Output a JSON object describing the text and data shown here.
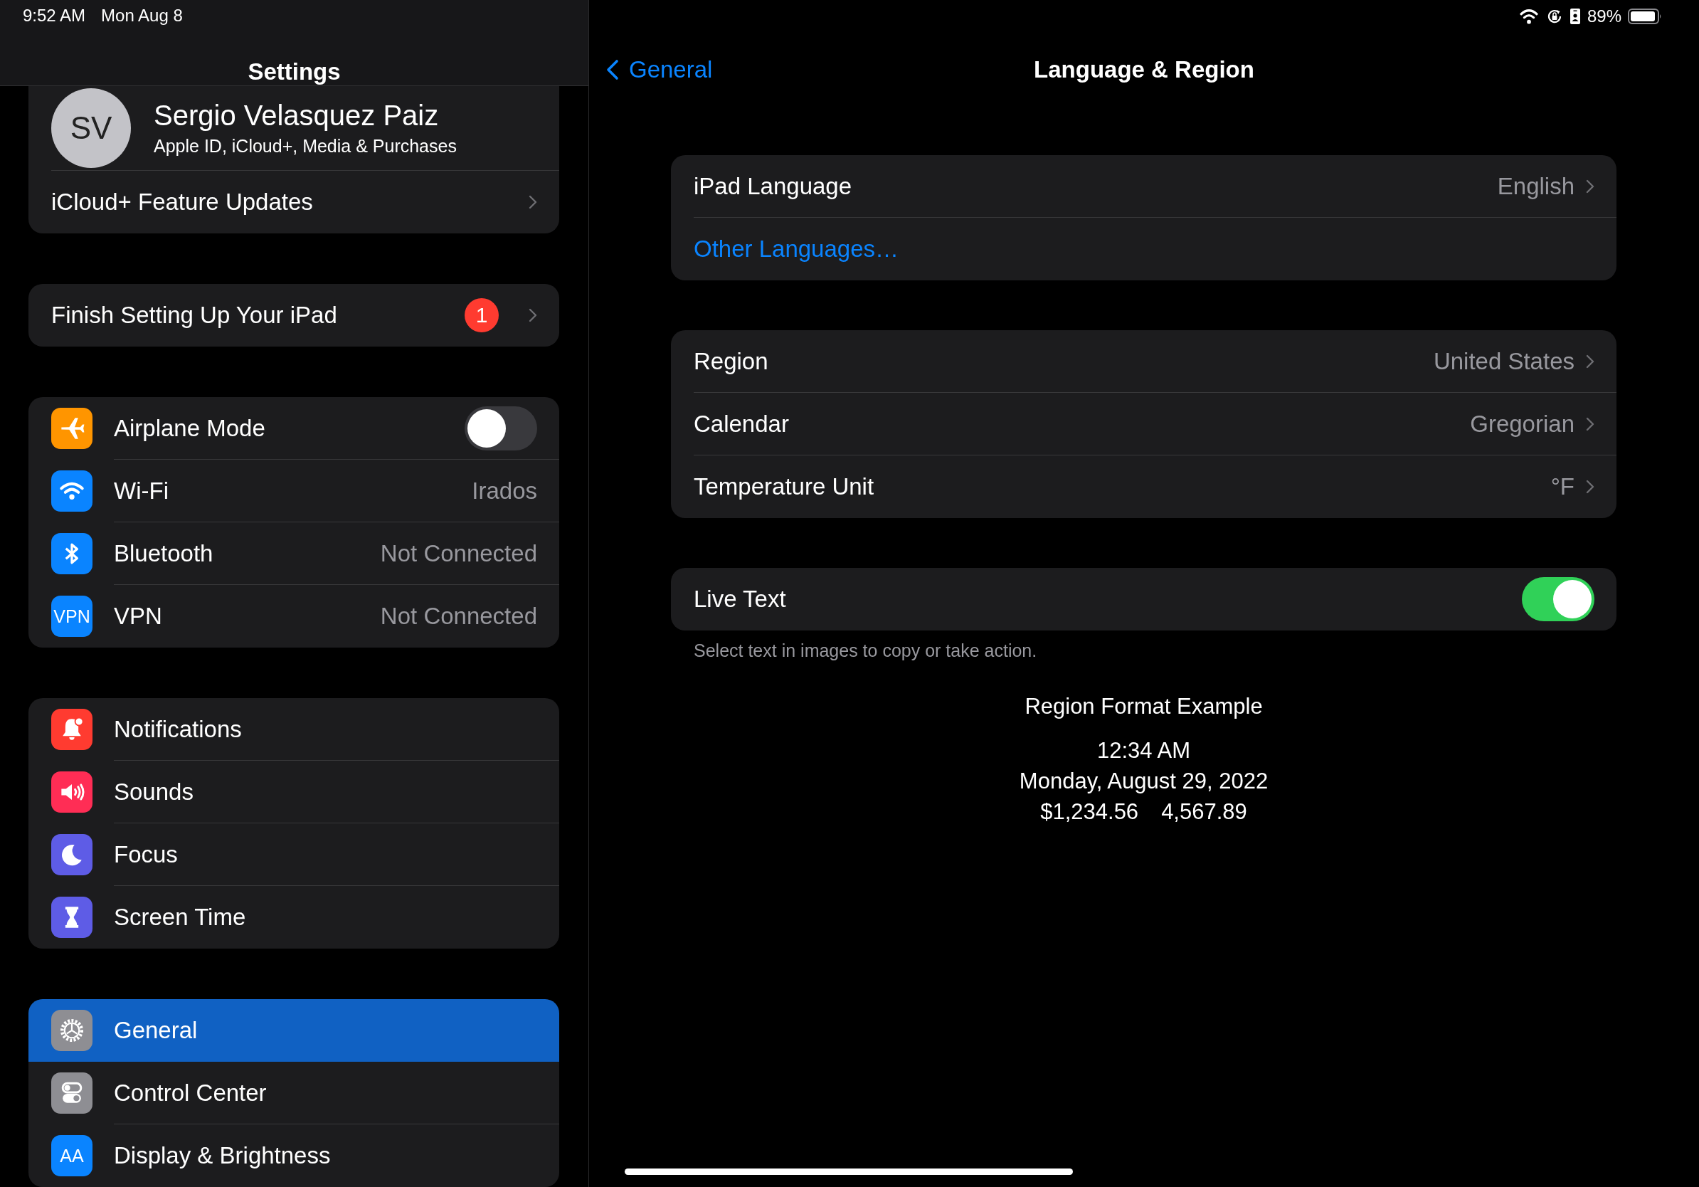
{
  "status_bar": {
    "time": "9:52 AM",
    "date": "Mon Aug 8",
    "battery": "89%"
  },
  "sidebar": {
    "title": "Settings",
    "account": {
      "initials": "SV",
      "name": "Sergio Velasquez Paiz",
      "subtitle": "Apple ID, iCloud+, Media & Purchases",
      "items": [
        {
          "kind": "chevron",
          "label": "iCloud+ Feature Updates",
          "selected": false
        }
      ]
    },
    "groups": [
      {
        "items": [
          {
            "kind": "chevron",
            "label": "Finish Setting Up Your iPad",
            "badge": "1",
            "selected": false
          }
        ]
      },
      {
        "items": [
          {
            "kind": "toggle",
            "label": "Airplane Mode",
            "color": "#ff9500",
            "on": false,
            "selected": false
          },
          {
            "kind": "plain",
            "label": "Wi-Fi",
            "color": "#0a84ff",
            "value": "Irados",
            "selected": false
          },
          {
            "kind": "plain",
            "label": "Bluetooth",
            "color": "#0a84ff",
            "value": "Not Connected",
            "selected": false
          },
          {
            "kind": "plain",
            "label": "VPN",
            "color": "#0a84ff",
            "icon_text": "VPN",
            "value": "Not Connected",
            "selected": false
          }
        ]
      },
      {
        "items": [
          {
            "kind": "plain",
            "label": "Notifications",
            "color": "#ff3b30",
            "selected": false
          },
          {
            "kind": "plain",
            "label": "Sounds",
            "color": "#ff2d55",
            "selected": false
          },
          {
            "kind": "plain",
            "label": "Focus",
            "color": "#5e5ce6",
            "selected": false
          },
          {
            "kind": "plain",
            "label": "Screen Time",
            "color": "#5e5ce6",
            "selected": false
          }
        ]
      },
      {
        "items": [
          {
            "kind": "plain",
            "label": "General",
            "color": "#8e8e93",
            "selected": true
          },
          {
            "kind": "plain",
            "label": "Control Center",
            "color": "#8e8e93",
            "selected": false
          },
          {
            "kind": "plain",
            "label": "Display & Brightness",
            "color": "#0a84ff",
            "icon_text": "AA",
            "selected": false
          }
        ]
      }
    ]
  },
  "detail": {
    "back": "General",
    "title": "Language & Region",
    "groups": [
      {
        "items": [
          {
            "kind": "value",
            "label": "iPad Language",
            "value": "English"
          },
          {
            "kind": "link",
            "label": "Other Languages…"
          }
        ]
      },
      {
        "items": [
          {
            "kind": "value",
            "label": "Region",
            "value": "United States"
          },
          {
            "kind": "value",
            "label": "Calendar",
            "value": "Gregorian"
          },
          {
            "kind": "value",
            "label": "Temperature Unit",
            "value": "°F"
          }
        ]
      },
      {
        "items": [
          {
            "kind": "toggle",
            "label": "Live Text",
            "on": true
          }
        ],
        "footer": "Select text in images to copy or take action."
      }
    ],
    "example": {
      "title": "Region Format Example",
      "lines": [
        "12:34 AM",
        "Monday, August 29, 2022"
      ],
      "amounts": [
        "$1,234.56",
        "4,567.89"
      ]
    }
  }
}
